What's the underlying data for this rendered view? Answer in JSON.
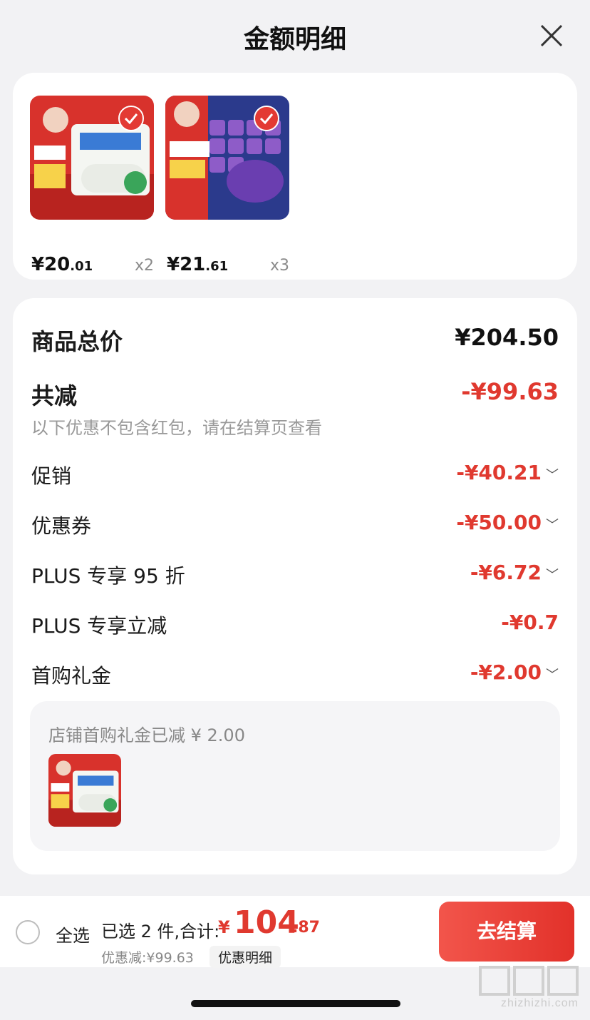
{
  "header": {
    "title": "金额明细"
  },
  "products": [
    {
      "price_int": "¥20",
      "price_dec": ".01",
      "qty": "x2"
    },
    {
      "price_int": "¥21",
      "price_dec": ".61",
      "qty": "x3"
    }
  ],
  "details": {
    "total_label": "商品总价",
    "total_value": "¥204.50",
    "discount_label": "共减",
    "discount_value": "-¥99.63",
    "discount_note": "以下优惠不包含红包，请在结算页查看",
    "items": [
      {
        "label": "促销",
        "value": "-¥40.21",
        "expandable": true
      },
      {
        "label": "优惠券",
        "value": "-¥50.00",
        "expandable": true
      },
      {
        "label": "PLUS 专享 95 折",
        "value": "-¥6.72",
        "expandable": true
      },
      {
        "label": "PLUS 专享立减",
        "value": "-¥0.7",
        "expandable": false
      },
      {
        "label": "首购礼金",
        "value": "-¥2.00",
        "expandable": true
      }
    ],
    "gift_note": "店铺首购礼金已减 ¥ 2.00"
  },
  "bottom": {
    "select_all": "全选",
    "selected_text": "已选 2 件,合计:",
    "currency": "¥",
    "total_int": "104",
    "total_dec": ".87",
    "saved": "优惠减:¥99.63",
    "detail_button": "优惠明细",
    "checkout_button": "去结算"
  },
  "watermark": {
    "text": "zhizhizhi.com"
  },
  "colors": {
    "accent": "#e0392f",
    "background": "#f2f2f4"
  }
}
